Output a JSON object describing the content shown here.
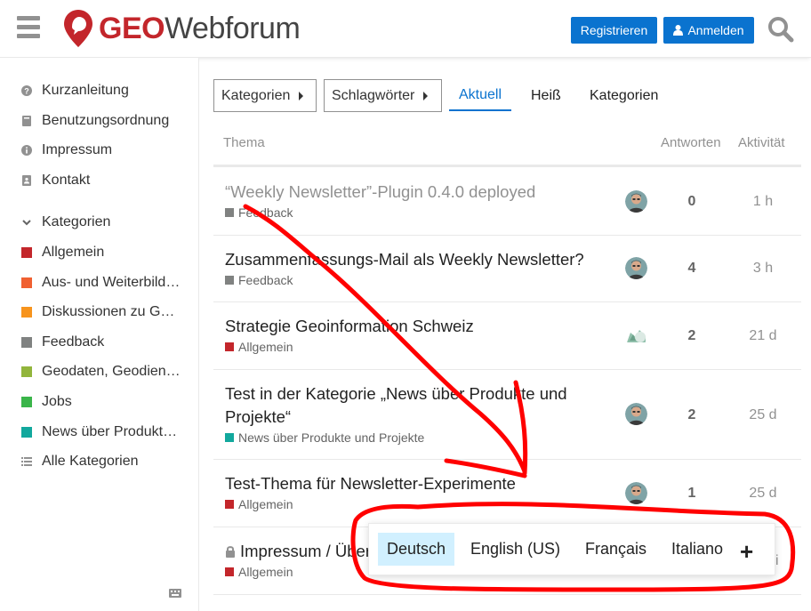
{
  "header": {
    "logo_geo": "GEO",
    "logo_web": "Webforum",
    "register_label": "Registrieren",
    "login_label": "Anmelden",
    "icons": [
      "hamburger-menu-icon",
      "search-icon",
      "user-icon"
    ],
    "accent_color": "#0a73cf",
    "brand_color": "#c3262b"
  },
  "sidebar": {
    "links": [
      {
        "label": "Kurzanleitung",
        "icon": "question-circle-icon"
      },
      {
        "label": "Benutzungsordnung",
        "icon": "book-icon"
      },
      {
        "label": "Impressum",
        "icon": "info-circle-icon"
      },
      {
        "label": "Kontakt",
        "icon": "address-card-icon"
      }
    ],
    "categories_header": "Kategorien",
    "categories": [
      {
        "label": "Allgemein",
        "color": "#c3262b"
      },
      {
        "label": "Aus- und Weiterbildung",
        "color": "#f06031"
      },
      {
        "label": "Diskussionen zu Geoinformation",
        "color": "#f7941d"
      },
      {
        "label": "Feedback",
        "color": "#808281"
      },
      {
        "label": "Geodaten, Geodienste",
        "color": "#92b53c"
      },
      {
        "label": "Jobs",
        "color": "#3ab54a"
      },
      {
        "label": "News über Produkte und Projekte",
        "color": "#12a89d"
      }
    ],
    "all_categories": "Alle Kategorien"
  },
  "nav": {
    "categories_dropdown": "Kategorien",
    "tags_dropdown": "Schlagwörter",
    "tabs": [
      "Aktuell",
      "Heiß",
      "Kategorien"
    ]
  },
  "list": {
    "columns": {
      "topic": "Thema",
      "replies": "Antworten",
      "activity": "Aktivität"
    },
    "topics": [
      {
        "title": "“Weekly Newsletter”-Plugin 0.4.0 deployed",
        "category": "Feedback",
        "category_color": "#808281",
        "replies": "0",
        "activity": "1 h",
        "visited": true
      },
      {
        "title": "Zusammenfassungs-Mail als Weekly Newsletter?",
        "category": "Feedback",
        "category_color": "#808281",
        "replies": "4",
        "activity": "3 h",
        "visited": false
      },
      {
        "title": "Strategie Geoinformation Schweiz",
        "category": "Allgemein",
        "category_color": "#c3262b",
        "replies": "2",
        "activity": "21 d",
        "visited": false
      },
      {
        "title": "Test in der Kategorie „News über Produkte und Projekte“",
        "category": "News über Produkte und Projekte",
        "category_color": "#12a89d",
        "replies": "2",
        "activity": "25 d",
        "visited": false
      },
      {
        "title": "Test-Thema für Newsletter-Experimente",
        "category": "Allgemein",
        "category_color": "#c3262b",
        "replies": "1",
        "activity": "25 d",
        "visited": false
      },
      {
        "title": "Impressum / Über",
        "category": "Allgemein",
        "category_color": "#c3262b",
        "replies": "",
        "activity": "li",
        "visited": false,
        "locked": true
      }
    ]
  },
  "language_picker": {
    "languages": [
      "Deutsch",
      "English (US)",
      "Français",
      "Italiano"
    ],
    "active": "Deutsch",
    "more_label": "+"
  }
}
